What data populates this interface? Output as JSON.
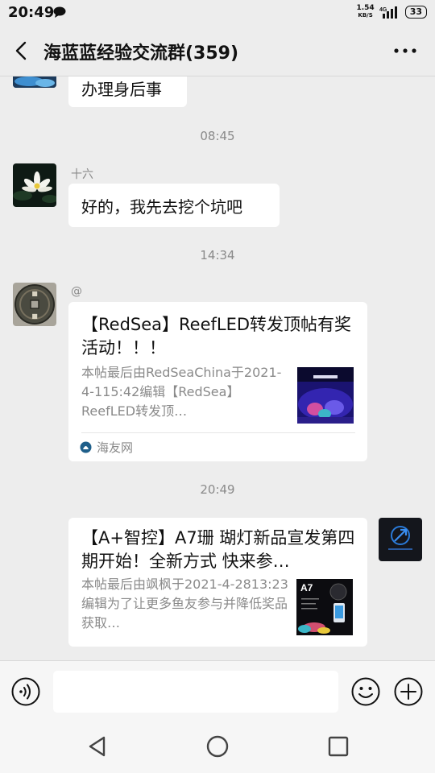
{
  "status_bar": {
    "time": "20:49",
    "net_speed_value": "1.54",
    "net_speed_unit": "KB/S",
    "network": "4G",
    "battery": "33"
  },
  "header": {
    "title": "海蓝蓝经验交流群(359)",
    "back_icon": "chevron-left",
    "more_icon": "three-dots"
  },
  "messages": [
    {
      "type": "text",
      "side": "left",
      "text": "办理身后事"
    },
    {
      "type": "timestamp",
      "text": "08:45"
    },
    {
      "type": "text",
      "side": "left",
      "sender": "十六",
      "text": "好的，我先去挖个坑吧"
    },
    {
      "type": "timestamp",
      "text": "14:34"
    },
    {
      "type": "link_card",
      "side": "left",
      "sender": "@",
      "title": "【RedSea】ReefLED转发顶帖有奖活动！！！",
      "desc": "本帖最后由RedSeaChina于2021-4-115:42编辑【RedSea】ReefLED转发顶…",
      "source": "海友网"
    },
    {
      "type": "timestamp",
      "text": "20:49"
    },
    {
      "type": "link_card",
      "side": "right",
      "title": "【A+智控】A7珊 瑚灯新品宣发第四期开始！全新方式  快来参…",
      "desc": "本帖最后由飒枫于2021-4-2813:23编辑为了让更多鱼友参与并降低奖品获取…",
      "thumb_label": "A7"
    }
  ],
  "colors": {
    "background": "#ededed",
    "bubble": "#ffffff",
    "secondary_text": "#8a8a8a"
  }
}
